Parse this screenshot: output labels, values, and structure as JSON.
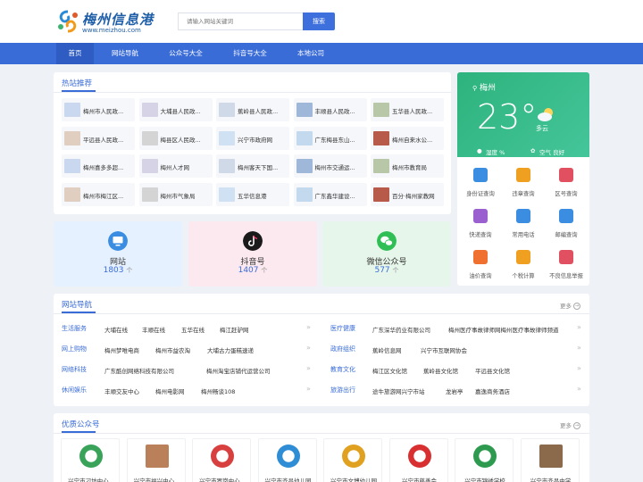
{
  "header": {
    "logo_title": "梅州信息港",
    "logo_url": "www.meizhou.com",
    "search_placeholder": "请输入网站关键词",
    "search_button": "搜索"
  },
  "nav": {
    "items": [
      "首页",
      "网站导航",
      "公众号大全",
      "抖音号大全",
      "本地公司"
    ]
  },
  "hot": {
    "title": "热站推荐",
    "items": [
      "梅州市人民政...",
      "大埔县人民政...",
      "蕉岭县人民政...",
      "丰顺县人民政...",
      "五华县人民政...",
      "平远县人民政...",
      "梅县区人民政...",
      "兴宁市政府网",
      "广东梅县东山...",
      "梅州自来水公...",
      "梅州喜多多超...",
      "梅州人才网",
      "梅州客天下国...",
      "梅州市交通运...",
      "梅州市教育局",
      "梅州市梅江区...",
      "梅州市气象局",
      "五华信息港",
      "广东鑫华建设...",
      "百分·梅州家教网"
    ]
  },
  "weather": {
    "city": "梅州",
    "temp": "23°",
    "condition": "多云",
    "humidity": "湿度 %",
    "air": "空气 良好"
  },
  "utilities": [
    {
      "label": "身份证查询",
      "icon": "id-card-icon",
      "color": "#3a8de0"
    },
    {
      "label": "违章查询",
      "icon": "violation-icon",
      "color": "#f0a020"
    },
    {
      "label": "区号查询",
      "icon": "phone-icon",
      "color": "#e05060"
    },
    {
      "label": "快递查询",
      "icon": "package-icon",
      "color": "#9a60d0"
    },
    {
      "label": "常用电话",
      "icon": "mobile-icon",
      "color": "#3a8de0"
    },
    {
      "label": "邮编查询",
      "icon": "mail-icon",
      "color": "#3a8de0"
    },
    {
      "label": "油价查询",
      "icon": "fuel-icon",
      "color": "#f07030"
    },
    {
      "label": "个税计算",
      "icon": "tax-icon",
      "color": "#f0a020"
    },
    {
      "label": "不良信息举报",
      "icon": "report-icon",
      "color": "#e05060"
    }
  ],
  "stats": [
    {
      "name": "网站",
      "count": "1803",
      "unit": "个"
    },
    {
      "name": "抖音号",
      "count": "1407",
      "unit": "个"
    },
    {
      "name": "微信公众号",
      "count": "577",
      "unit": "个"
    }
  ],
  "sitenav": {
    "title": "网站导航",
    "more": "更多",
    "left": [
      {
        "cat": "生活服务",
        "links": [
          "大埔在线",
          "丰顺在线",
          "五华在线",
          "梅江赶驴网"
        ]
      },
      {
        "cat": "网上购物",
        "links": [
          "梅州梦唯电商",
          "梅州市益农淘",
          "大埔古力蛋糕速递"
        ]
      },
      {
        "cat": "网络科技",
        "links": [
          "广东酷创网络科技有限公司",
          "梅州淘宝店铺代运营公司"
        ]
      },
      {
        "cat": "休闲娱乐",
        "links": [
          "丰顺交友中心",
          "梅州电影网",
          "梅州畅谈108"
        ]
      }
    ],
    "right": [
      {
        "cat": "医疗健康",
        "links": [
          "广东深华药业有限公司",
          "梅州医疗事故律师网梅州医疗事故律师频道"
        ]
      },
      {
        "cat": "政府组织",
        "links": [
          "蕉岭信息网",
          "兴宁市互联网协会"
        ]
      },
      {
        "cat": "教育文化",
        "links": [
          "梅江区文化馆",
          "蕉岭县文化馆",
          "平远县文化馆"
        ]
      },
      {
        "cat": "旅游出行",
        "links": [
          "途牛旅游网兴宁市站",
          "龙岩亭",
          "嘉逸商务酒店"
        ]
      }
    ]
  },
  "pub": {
    "title": "优质公众号",
    "more": "更多",
    "items": [
      "兴宁市刁坊中心...",
      "兴宁市福兴中心...",
      "兴宁市罗岗中心...",
      "兴宁市齐昌幼儿园",
      "兴宁市文博幼儿园",
      "兴宁市慈善会",
      "兴宁市锦绣学校",
      "兴宁市齐昌中学"
    ]
  }
}
